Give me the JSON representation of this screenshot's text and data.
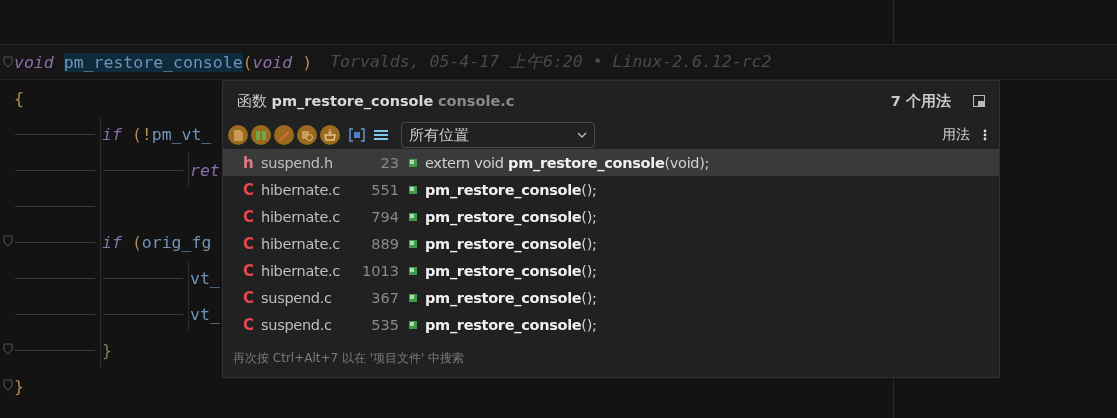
{
  "editor": {
    "lines": [
      {
        "fold": true,
        "current": true,
        "tokens": [
          {
            "kind": "keyword",
            "text": "void"
          },
          {
            "kind": "target",
            "text": "pm_restore_console"
          },
          {
            "kind": "paren",
            "text": "("
          },
          {
            "kind": "keyword",
            "text": "void"
          },
          {
            "kind": "paren",
            "text": ")"
          }
        ],
        "blame": "Torvalds, 05-4-17 上午6:20 • Linux-2.6.12-rc2"
      },
      {
        "fold": false,
        "current": false,
        "tokens": [
          {
            "kind": "brace",
            "text": "{"
          }
        ],
        "children": [
          {
            "fold": false,
            "current": false,
            "tokens": [
              {
                "kind": "keyword",
                "text": "if"
              },
              {
                "kind": "paren",
                "text": "(!"
              },
              {
                "kind": "ident",
                "text": "pm_vt_"
              }
            ],
            "children": [
              {
                "fold": false,
                "current": false,
                "tokens": [
                  {
                    "kind": "keyword",
                    "text": "ret"
                  }
                ]
              }
            ]
          },
          {
            "fold": false,
            "current": false
          },
          {
            "fold": true,
            "current": false,
            "tokens": [
              {
                "kind": "keyword",
                "text": "if"
              },
              {
                "kind": "paren",
                "text": "("
              },
              {
                "kind": "ident",
                "text": "orig_fg"
              }
            ],
            "children": [
              {
                "fold": false,
                "current": false,
                "tokens": [
                  {
                    "kind": "ident",
                    "text": "vt_"
                  }
                ]
              },
              {
                "fold": false,
                "current": false,
                "tokens": [
                  {
                    "kind": "ident",
                    "text": "vt_"
                  }
                ]
              }
            ]
          },
          {
            "fold": true,
            "current": false,
            "tokens": [
              {
                "kind": "brace2",
                "text": "}"
              }
            ]
          }
        ]
      },
      {
        "fold": true,
        "current": false,
        "tokens": [
          {
            "kind": "brace",
            "text": "}"
          }
        ]
      }
    ]
  },
  "popup": {
    "kind_label": "函数",
    "symbol": "pm_restore_console",
    "file": "console.c",
    "usage_count": "7 个用法",
    "scope": "所有位置",
    "group_label": "用法",
    "results": [
      {
        "type": "h",
        "file": "suspend.h",
        "line": "23",
        "code": "extern void **pm_restore_console**(void);",
        "selected": true
      },
      {
        "type": "C",
        "file": "hibernate.c",
        "line": "551",
        "code": "**pm_restore_console**();",
        "selected": false
      },
      {
        "type": "C",
        "file": "hibernate.c",
        "line": "794",
        "code": "**pm_restore_console**();",
        "selected": false
      },
      {
        "type": "C",
        "file": "hibernate.c",
        "line": "889",
        "code": "**pm_restore_console**();",
        "selected": false
      },
      {
        "type": "C",
        "file": "hibernate.c",
        "line": "1013",
        "code": "**pm_restore_console**();",
        "selected": false
      },
      {
        "type": "C",
        "file": "suspend.c",
        "line": "367",
        "code": "**pm_restore_console**();",
        "selected": false
      },
      {
        "type": "C",
        "file": "suspend.c",
        "line": "535",
        "code": "**pm_restore_console**();",
        "selected": false
      }
    ],
    "hint": "再次按 Ctrl+Alt+7 以在 '项目文件' 中搜索"
  }
}
